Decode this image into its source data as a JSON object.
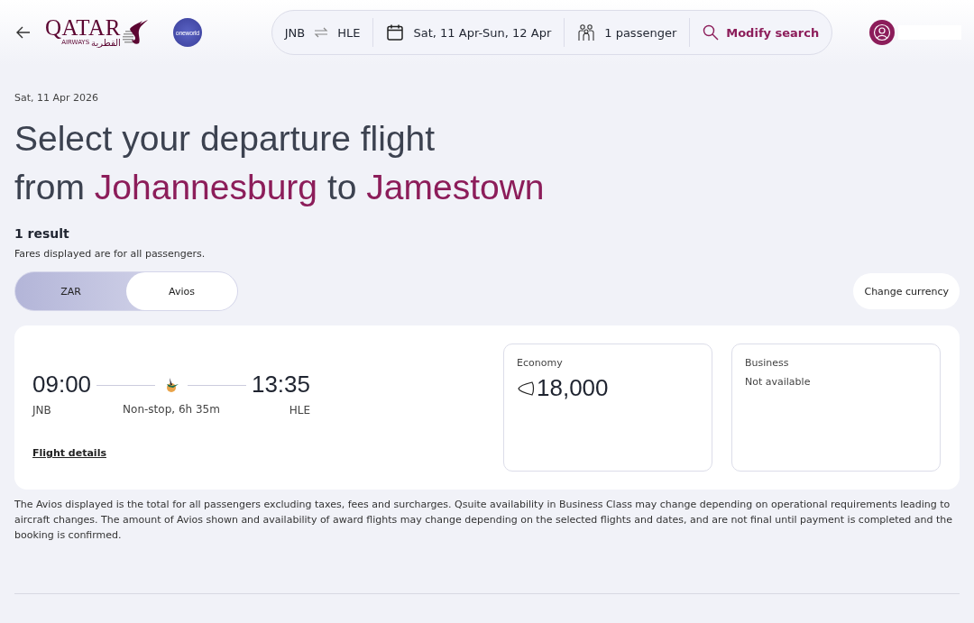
{
  "header": {
    "logo": {
      "name": "QATAR",
      "sub": "AIRWAYS",
      "arabic": "القطرية"
    },
    "alliance": "oneworld",
    "search_bar": {
      "origin": "JNB",
      "destination": "HLE",
      "dates": "Sat, 11 Apr-Sun, 12 Apr",
      "passengers": "1 passenger",
      "modify": "Modify search"
    }
  },
  "date": "Sat, 11 Apr 2026",
  "heading": {
    "line1": "Select your departure flight",
    "from_word": "from",
    "origin": "Johannesburg",
    "to_word": "to",
    "destination": "Jamestown"
  },
  "results": {
    "count": "1 result",
    "note": "Fares displayed are for all passengers."
  },
  "currency_tabs": [
    {
      "label": "ZAR",
      "selected": false
    },
    {
      "label": "Avios",
      "selected": true
    }
  ],
  "change_currency": "Change currency",
  "flight": {
    "depart_time": "09:00",
    "depart_code": "JNB",
    "arrive_time": "13:35",
    "arrive_code": "HLE",
    "duration": "Non-stop, 6h 35m",
    "details_link": "Flight details",
    "fares": [
      {
        "cabin": "Economy",
        "kind": "price",
        "value": "18,000"
      },
      {
        "cabin": "Business",
        "kind": "unavailable",
        "value": "Not available"
      }
    ]
  },
  "disclaimer": "The Avios displayed is the total for all passengers excluding taxes, fees and surcharges. Qsuite availability in Business Class may change depending on operational requirements leading to aircraft changes. The amount of Avios shown and availability of award flights may change depending on the selected flights and dates, and are not final until payment is completed and the booking is confirmed."
}
